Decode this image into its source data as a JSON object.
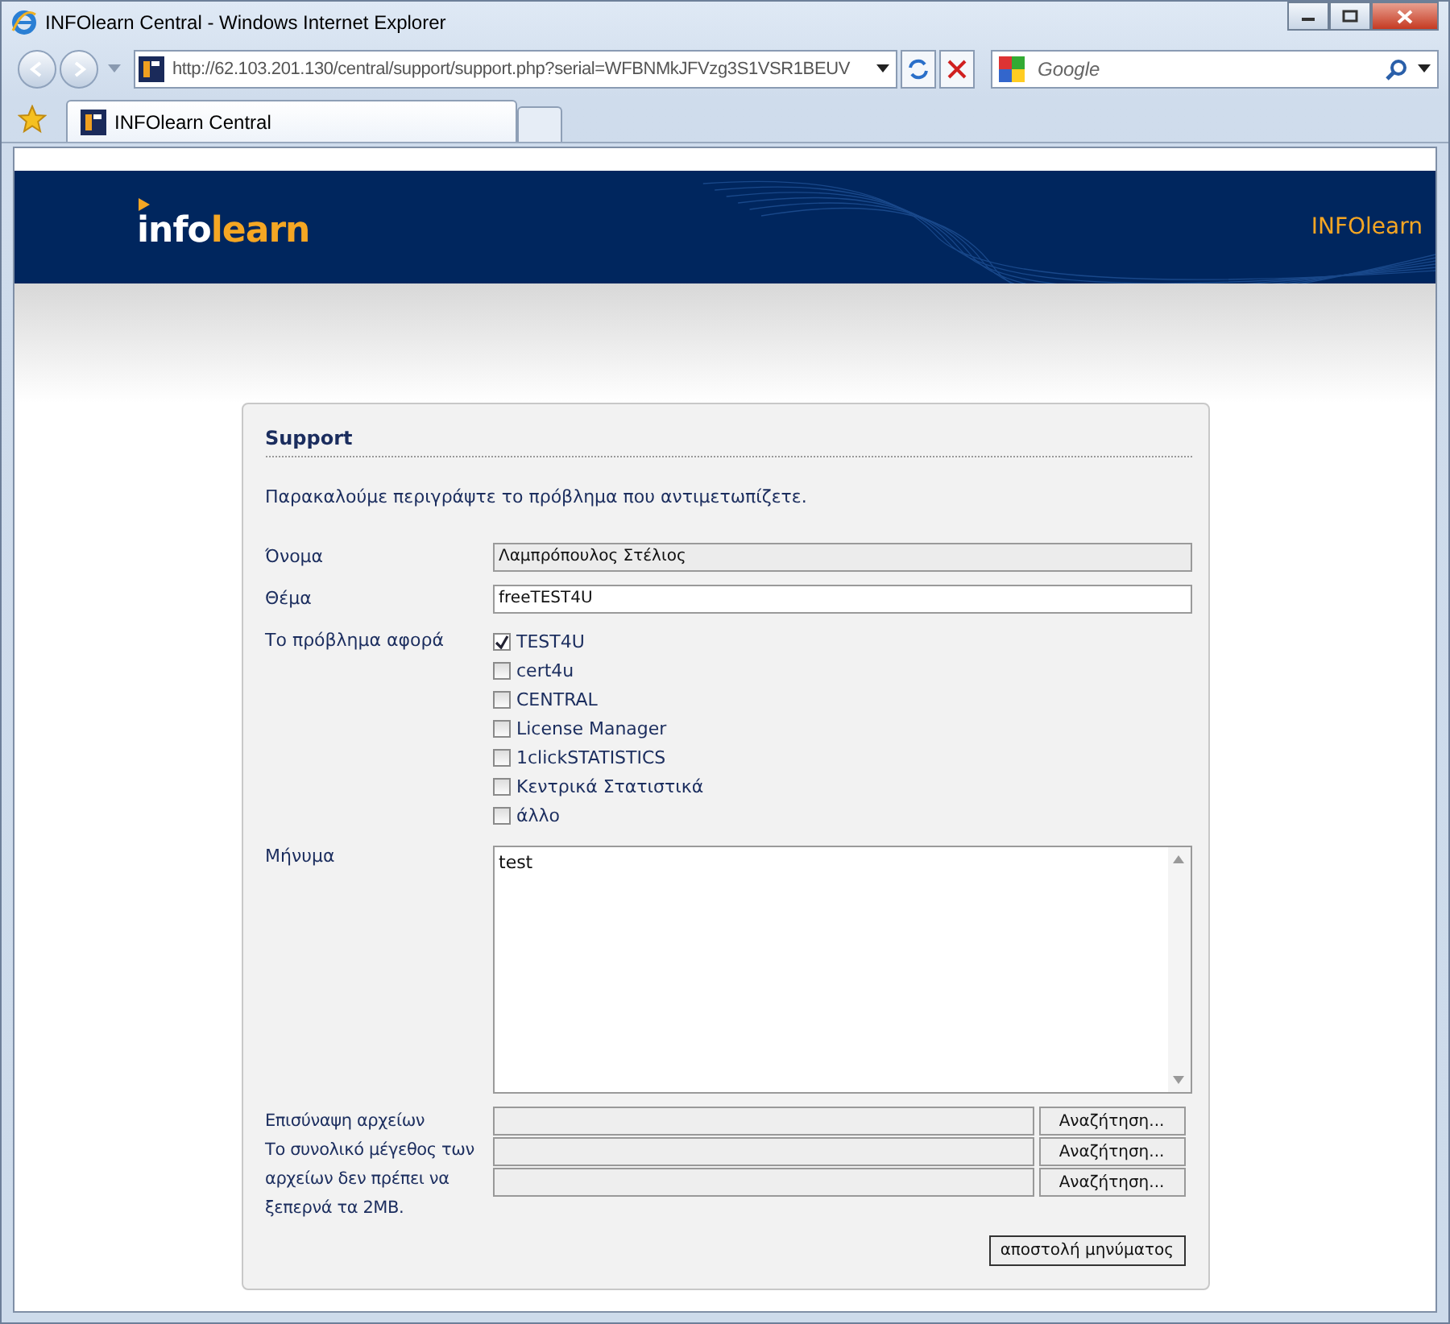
{
  "window": {
    "title": "INFOlearn Central - Windows Internet Explorer"
  },
  "toolbar": {
    "address": "http://62.103.201.130/central/support/support.php?serial=WFBNMkJFVzg3S1VSR1BEUV",
    "search_placeholder": "Google"
  },
  "tabs": [
    {
      "label": "INFOlearn Central",
      "selected": true
    }
  ],
  "banner": {
    "logo": [
      "info",
      "learn"
    ],
    "brand": "INFOlearn"
  },
  "form": {
    "title": "Support",
    "intro": "Παρακαλούμε περιγράψτε το πρόβλημα που αντιμετωπίζετε.",
    "fields": [
      {
        "label": "Όνομα",
        "value": "Λαμπρόπουλος Στέλιος",
        "disabled": true
      },
      {
        "label": "Θέμα",
        "value": "freeTEST4U",
        "disabled": false
      }
    ],
    "topic_label": "Το πρόβλημα αφορά",
    "topics": [
      {
        "label": "TEST4U",
        "checked": true
      },
      {
        "label": "cert4u",
        "checked": false
      },
      {
        "label": "CENTRAL",
        "checked": false
      },
      {
        "label": "License Manager",
        "checked": false
      },
      {
        "label": "1clickSTATISTICS",
        "checked": false
      },
      {
        "label": "Κεντρικά Στατιστικά",
        "checked": false
      },
      {
        "label": "άλλο",
        "checked": false
      }
    ],
    "message_label": "Μήνυμα",
    "message": "test",
    "attach_label": "Επισύναψη αρχείων",
    "attach_note": "Το συνολικό μέγεθος των αρχείων δεν πρέπει να ξεπερνά τα 2MB.",
    "browse_buttons": [
      "Αναζήτηση...",
      "Αναζήτηση...",
      "Αναζήτηση..."
    ],
    "submit": "αποστολή μηνύματος"
  }
}
